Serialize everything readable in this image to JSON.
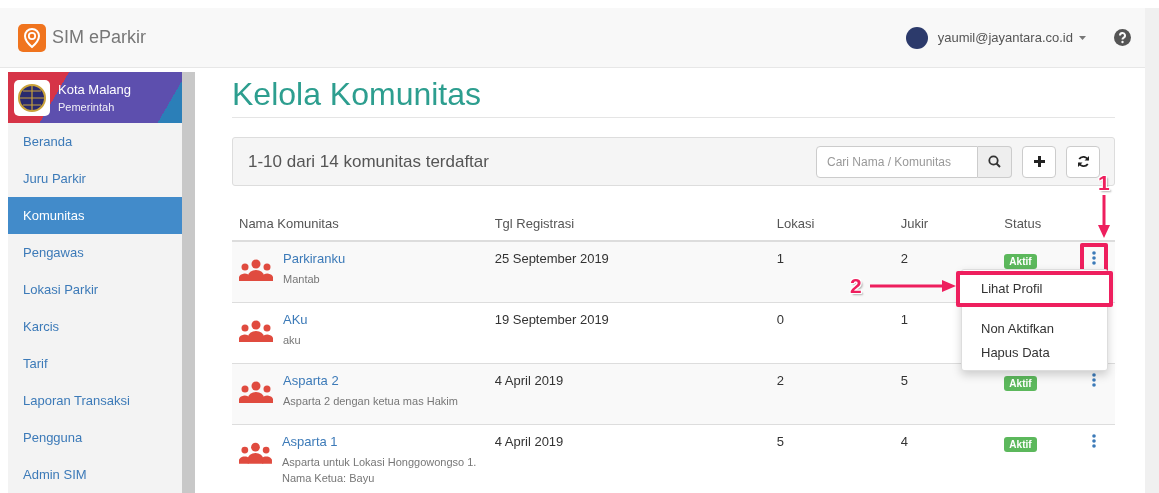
{
  "app": {
    "name": "SIM eParkir"
  },
  "user": {
    "email": "yaumil@jayantara.co.id"
  },
  "sidebar": {
    "org": {
      "name": "Kota Malang",
      "role": "Pemerintah"
    },
    "items": [
      {
        "label": "Beranda",
        "selected": false
      },
      {
        "label": "Juru Parkir",
        "selected": false
      },
      {
        "label": "Komunitas",
        "selected": true
      },
      {
        "label": "Pengawas",
        "selected": false
      },
      {
        "label": "Lokasi Parkir",
        "selected": false
      },
      {
        "label": "Karcis",
        "selected": false
      },
      {
        "label": "Tarif",
        "selected": false
      },
      {
        "label": "Laporan Transaksi",
        "selected": false
      },
      {
        "label": "Pengguna",
        "selected": false
      },
      {
        "label": "Admin SIM",
        "selected": false
      }
    ]
  },
  "page_title": "Kelola Komunitas",
  "toolbar": {
    "summary": "1-10 dari 14 komunitas terdaftar",
    "search": {
      "placeholder": "Cari Nama / Komunitas"
    }
  },
  "table": {
    "columns": [
      "Nama Komunitas",
      "Tgl Registrasi",
      "Lokasi",
      "Jukir",
      "Status"
    ],
    "rows": [
      {
        "name": "Parkiranku",
        "description": "Mantab",
        "date": "25 September 2019",
        "lokasi": "1",
        "jukir": "2",
        "status": "Aktif",
        "menu_open": true
      },
      {
        "name": "AKu",
        "description": "aku",
        "date": "19 September 2019",
        "lokasi": "0",
        "jukir": "1",
        "menu_open": false
      },
      {
        "name": "Asparta 2",
        "description": "Asparta 2 dengan ketua mas Hakim",
        "date": "4 April 2019",
        "lokasi": "2",
        "jukir": "5",
        "status": "Aktif",
        "menu_open": false
      },
      {
        "name": "Asparta 1",
        "description": "Asparta untuk Lokasi Honggowongso 1. Nama Ketua: Bayu",
        "date": "4 April 2019",
        "lokasi": "5",
        "jukir": "4",
        "status": "Aktif",
        "menu_open": false
      }
    ]
  },
  "row_menu": {
    "items": [
      {
        "label": "Lihat Profil",
        "highlighted": true
      },
      {
        "label": "Non Aktifkan",
        "highlighted": false
      },
      {
        "label": "Hapus Data",
        "highlighted": false
      }
    ]
  },
  "annotations": [
    {
      "label": "1"
    },
    {
      "label": "2"
    }
  ]
}
